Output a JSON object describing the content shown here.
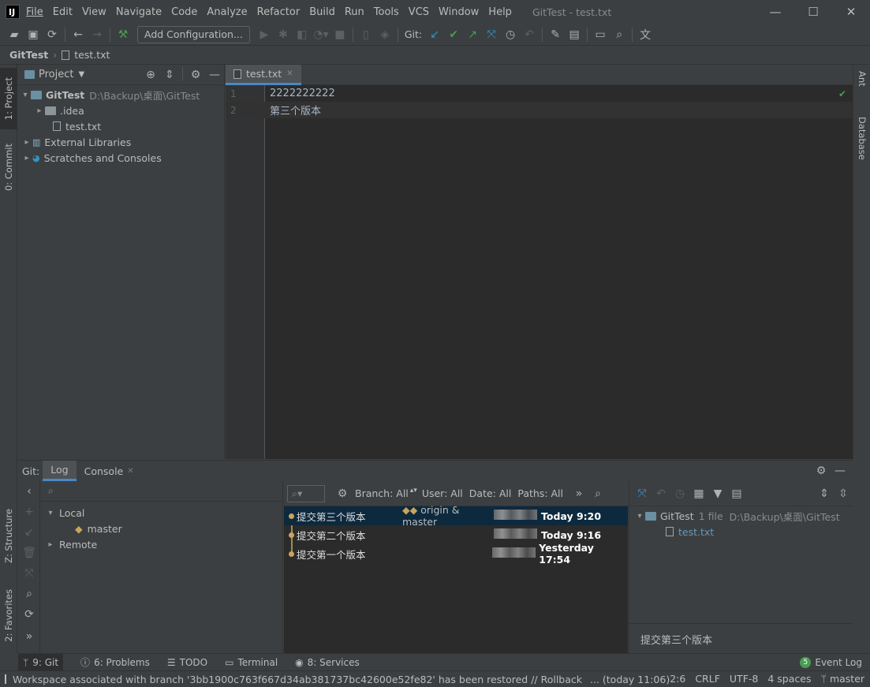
{
  "title_bar": {
    "logo": "IJ",
    "window_title": "GitTest - test.txt",
    "menu": [
      "File",
      "Edit",
      "View",
      "Navigate",
      "Code",
      "Analyze",
      "Refactor",
      "Build",
      "Run",
      "Tools",
      "VCS",
      "Window",
      "Help"
    ],
    "controls": [
      "minimize-icon",
      "maximize-icon",
      "close-icon"
    ]
  },
  "toolbar": {
    "add_configuration": "Add Configuration...",
    "git_label": "Git:"
  },
  "breadcrumb": {
    "project": "GitTest",
    "file": "test.txt"
  },
  "left_tool_tabs": {
    "project": "1: Project",
    "commit": "0: Commit",
    "structure": "Z: Structure",
    "favorites": "2: Favorites"
  },
  "right_tool_tabs": {
    "ant": "Ant",
    "database": "Database"
  },
  "project_panel": {
    "title": "Project",
    "root_name": "GitTest",
    "root_path": "D:\\Backup\\桌面\\GitTest",
    "items": [
      ".idea",
      "test.txt",
      "External Libraries",
      "Scratches and Consoles"
    ]
  },
  "editor": {
    "tab": "test.txt",
    "lines": [
      {
        "num": "1",
        "text": "2222222222"
      },
      {
        "num": "2",
        "text": "第三个版本"
      }
    ]
  },
  "git_panel": {
    "label": "Git:",
    "tabs": [
      "Log",
      "Console"
    ],
    "branches": {
      "local": "Local",
      "master": "master",
      "remote": "Remote"
    },
    "filters": {
      "branch": "Branch: All",
      "user": "User: All",
      "date": "Date: All",
      "paths": "Paths: All"
    },
    "commits": [
      {
        "message": "提交第三个版本",
        "refs": "origin & master",
        "date": "Today 9:20"
      },
      {
        "message": "提交第二个版本",
        "refs": "",
        "date": "Today 9:16"
      },
      {
        "message": "提交第一个版本",
        "refs": "",
        "date": "Yesterday 17:54"
      }
    ],
    "details": {
      "repo": "GitTest",
      "count": "1 file",
      "path": "D:\\Backup\\桌面\\GitTest",
      "file": "test.txt",
      "commit_message": "提交第三个版本"
    }
  },
  "bottom_tabs": [
    "9: Git",
    "6: Problems",
    "TODO",
    "Terminal",
    "8: Services"
  ],
  "event_log": {
    "count": "5",
    "label": "Event Log"
  },
  "status": {
    "message": "Workspace associated with branch '3bb1900c763f667d34ab381737bc42600e52fe82' has been restored // Rollback",
    "time": "... (today 11:06)",
    "position": "2:6",
    "line_sep": "CRLF",
    "encoding": "UTF-8",
    "indent": "4 spaces",
    "branch": "master"
  },
  "colors": {
    "background": "#3c3f41",
    "editor": "#2b2b2b",
    "selection": "#0d293e",
    "accent": "#4a88c7",
    "git_green": "#499c54",
    "git_blue": "#3592c4"
  }
}
